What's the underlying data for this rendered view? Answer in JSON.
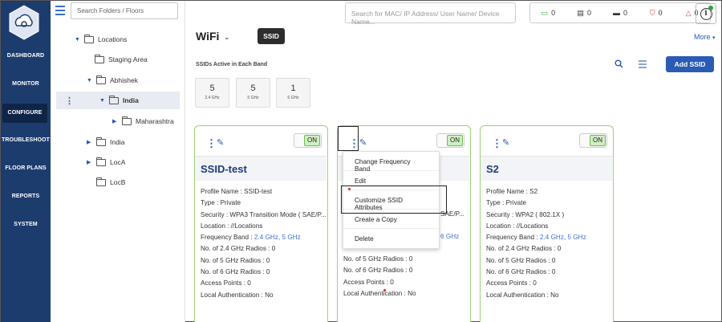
{
  "nav": {
    "items": [
      "DASHBOARD",
      "MONITOR",
      "CONFIGURE",
      "TROUBLESHOOT",
      "FLOOR PLANS",
      "REPORTS",
      "SYSTEM"
    ],
    "active": "CONFIGURE"
  },
  "tree": {
    "search_placeholder": "Search Folders / Floors",
    "items": [
      "Locations",
      "Staging Area",
      "Abhishek",
      "India",
      "Maharashtra",
      "India",
      "LocA",
      "LocB"
    ]
  },
  "topbar": {
    "search_placeholder": "Search for MAC/ IP Address/ User Name/ Device Name...",
    "stats": [
      "0",
      "0",
      "0",
      "0",
      "0"
    ]
  },
  "page": {
    "title": "WiFi",
    "tab": "SSID",
    "more": "More",
    "bands_label": "SSIDs Active in Each Band",
    "add_button": "Add SSID"
  },
  "bands": [
    {
      "count": "5",
      "label": "2.4 GHz"
    },
    {
      "count": "5",
      "label": "5 GHz"
    },
    {
      "count": "1",
      "label": "6 GHz"
    }
  ],
  "cards": [
    {
      "toggle": "ON",
      "name": "SSID-test",
      "profile": "Profile Name : SSID-test",
      "type": "Type : Private",
      "security": "Security : WPA3 Transition Mode ( SAE/P...",
      "location": "Location : //Locations",
      "band_label": "Frequency Band : ",
      "band_value": "2.4 GHz, 5 GHz",
      "r24": "No. of 2.4 GHz Radios : 0",
      "r5": "No. of 5 GHz Radios : 0",
      "r6": "No. of 6 GHz Radios : 0",
      "ap": "Access Points : 0",
      "auth": "Local Authentication : No"
    },
    {
      "toggle": "ON",
      "security_tail": "SAE/P...",
      "band_tail": "6 GHz",
      "r5": "No. of 5 GHz Radios : 0",
      "r6": "No. of 6 GHz Radios : 0",
      "ap": "Access Points : 0",
      "auth": "Local Authentication : No"
    },
    {
      "toggle": "ON",
      "name": "S2",
      "profile": "Profile Name : S2",
      "type": "Type : Private",
      "security": "Security : WPA2 ( 802.1X )",
      "location": "Location : //Locations",
      "band_label": "Frequency Band : ",
      "band_value": "2.4 GHz, 5 GHz",
      "r24": "No. of 2.4 GHz Radios : 0",
      "r5": "No. of 5 GHz Radios : 0",
      "r6": "No. of 6 GHz Radios : 0",
      "ap": "Access Points : 0",
      "auth": "Local Authentication : No"
    }
  ],
  "menu": {
    "items": [
      "Change Frequency Band",
      "Edit",
      "Customize SSID Attributes",
      "Create a Copy",
      "Delete"
    ]
  }
}
